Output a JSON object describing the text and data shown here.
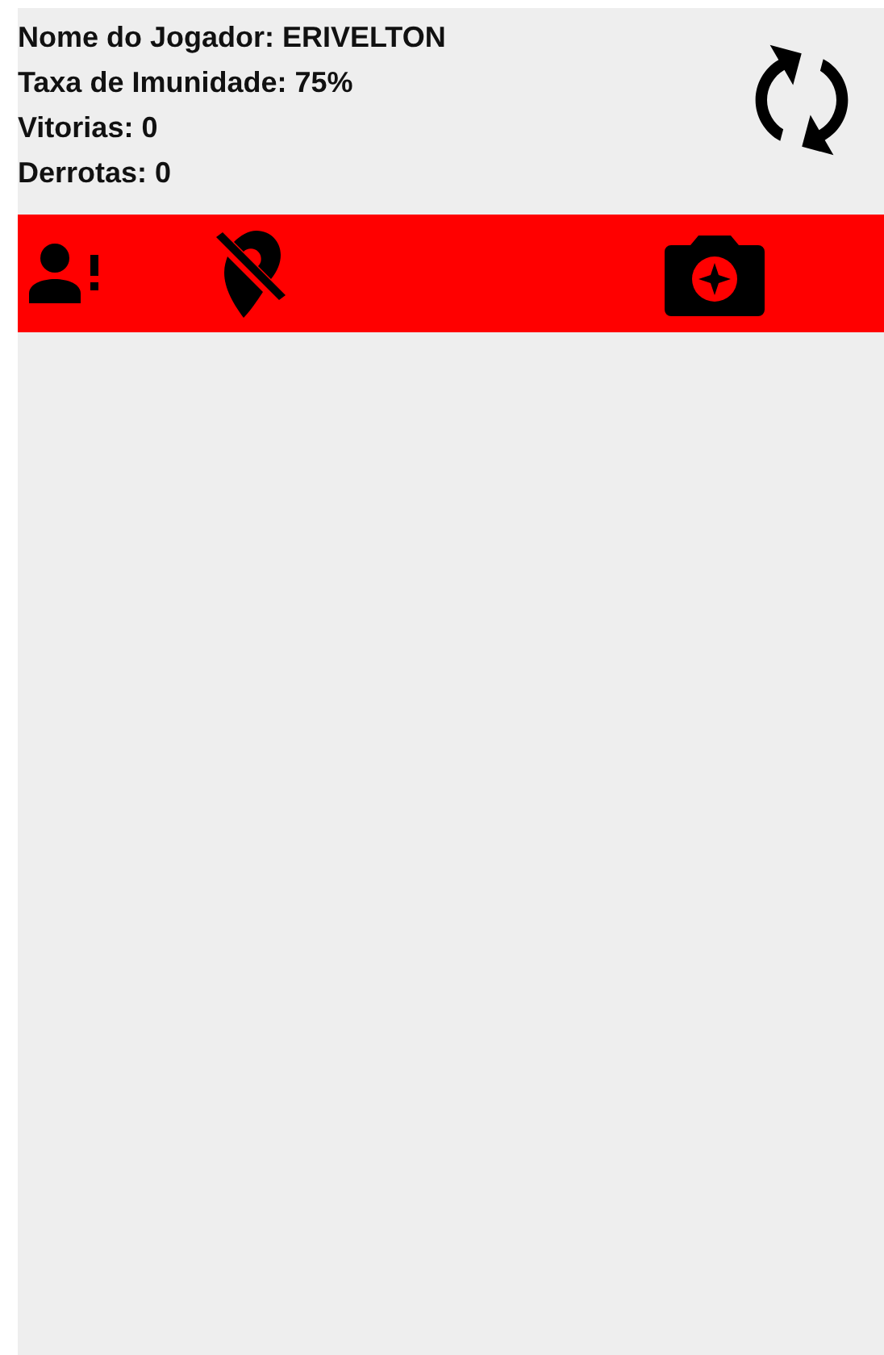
{
  "player": {
    "stats": [
      "Nome do Jogador: ERIVELTON",
      "Taxa de Imunidade: 75%",
      "Vitorias: 0",
      "Derrotas: 0"
    ]
  },
  "toolbar": {
    "color": "#ff0000"
  }
}
